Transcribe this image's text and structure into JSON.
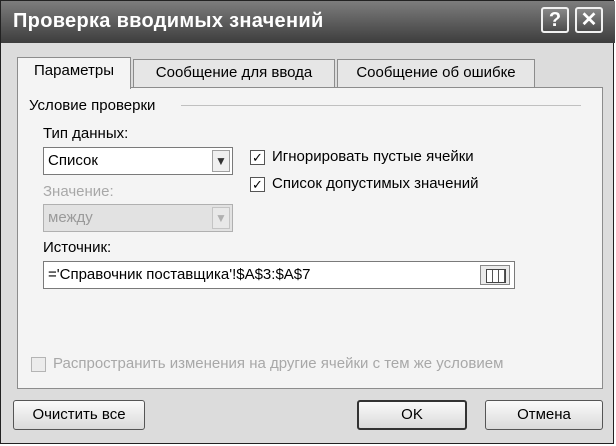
{
  "window": {
    "title": "Проверка вводимых значений",
    "help_glyph": "?",
    "close_glyph": "✕"
  },
  "tabs": [
    {
      "label": "Параметры",
      "active": true
    },
    {
      "label": "Сообщение для ввода",
      "active": false
    },
    {
      "label": "Сообщение об ошибке",
      "active": false
    }
  ],
  "group": {
    "title": "Условие проверки"
  },
  "data_type": {
    "label": "Тип данных:",
    "value": "Список"
  },
  "checkboxes": [
    {
      "label": "Игнорировать пустые ячейки",
      "checked": true
    },
    {
      "label": "Список допустимых значений",
      "checked": true
    }
  ],
  "value_field": {
    "label": "Значение:",
    "value": "между",
    "enabled": false
  },
  "source": {
    "label": "Источник:",
    "value": "='Справочник поставщика'!$A$3:$A$7"
  },
  "apply_all": {
    "label": "Распространить изменения на другие ячейки с тем же условием",
    "checked": false,
    "enabled": false
  },
  "buttons": {
    "clear": "Очистить все",
    "ok": "OK",
    "cancel": "Отмена"
  },
  "glyphs": {
    "check": "✓",
    "dropdown": "▼"
  },
  "colors": {
    "titlebar": "#3d3d3d",
    "face": "#dcdcdc",
    "panel": "#f4f4f4",
    "disabled_text": "#a8a8a8"
  },
  "icons": {
    "help": "help-icon",
    "close": "close-icon",
    "dropdown": "chevron-down-icon",
    "range_select": "range-select-icon"
  }
}
